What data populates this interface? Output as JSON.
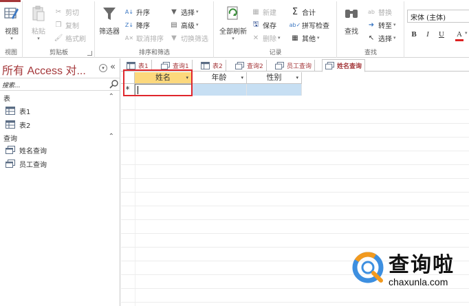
{
  "ribbon": {
    "views_group": {
      "label": "视图",
      "view_button": "视图"
    },
    "clipboard_group": {
      "label": "剪贴板",
      "paste": "粘贴",
      "cut": "剪切",
      "copy": "复制",
      "format_painter": "格式刷"
    },
    "sort_filter_group": {
      "label": "排序和筛选",
      "filter": "筛选器",
      "ascending": "升序",
      "descending": "降序",
      "remove_sort": "取消排序",
      "selection": "选择",
      "advanced": "高级",
      "toggle_filter": "切换筛选"
    },
    "records_group": {
      "label": "记录",
      "refresh_all": "全部刷新",
      "new": "新建",
      "save": "保存",
      "delete": "删除",
      "totals": "合计",
      "spelling": "拼写检查",
      "more": "其他"
    },
    "find_group": {
      "label": "查找",
      "find": "查找",
      "replace": "替换",
      "goto": "转至",
      "select": "选择"
    },
    "text_format": {
      "font_name": "宋体 (主体)",
      "bold": "B",
      "italic": "I",
      "underline": "U",
      "font_color": "A"
    }
  },
  "nav_pane": {
    "title": "所有 Access 对...",
    "search_placeholder": "搜索...",
    "sections": [
      {
        "header": "表",
        "items": [
          "表1",
          "表2"
        ]
      },
      {
        "header": "查询",
        "items": [
          "姓名查询",
          "员工查询"
        ]
      }
    ]
  },
  "doc_tabs": [
    {
      "label": "表1",
      "kind": "table"
    },
    {
      "label": "查询1",
      "kind": "query"
    },
    {
      "label": "表2",
      "kind": "table"
    },
    {
      "label": "查询2",
      "kind": "query"
    },
    {
      "label": "员工查询",
      "kind": "query"
    },
    {
      "label": "姓名查询",
      "kind": "query",
      "active": true
    }
  ],
  "datasheet": {
    "columns": [
      "姓名",
      "年龄",
      "性别"
    ],
    "new_record_marker": "*",
    "selected_column": "姓名"
  },
  "watermark": {
    "text": "查询啦",
    "url": "chaxunla.com"
  },
  "colors": {
    "accent": "#a4373a",
    "selection": "#fcd87c",
    "new_row": "#c7dff3",
    "highlight": "#e0262c"
  }
}
